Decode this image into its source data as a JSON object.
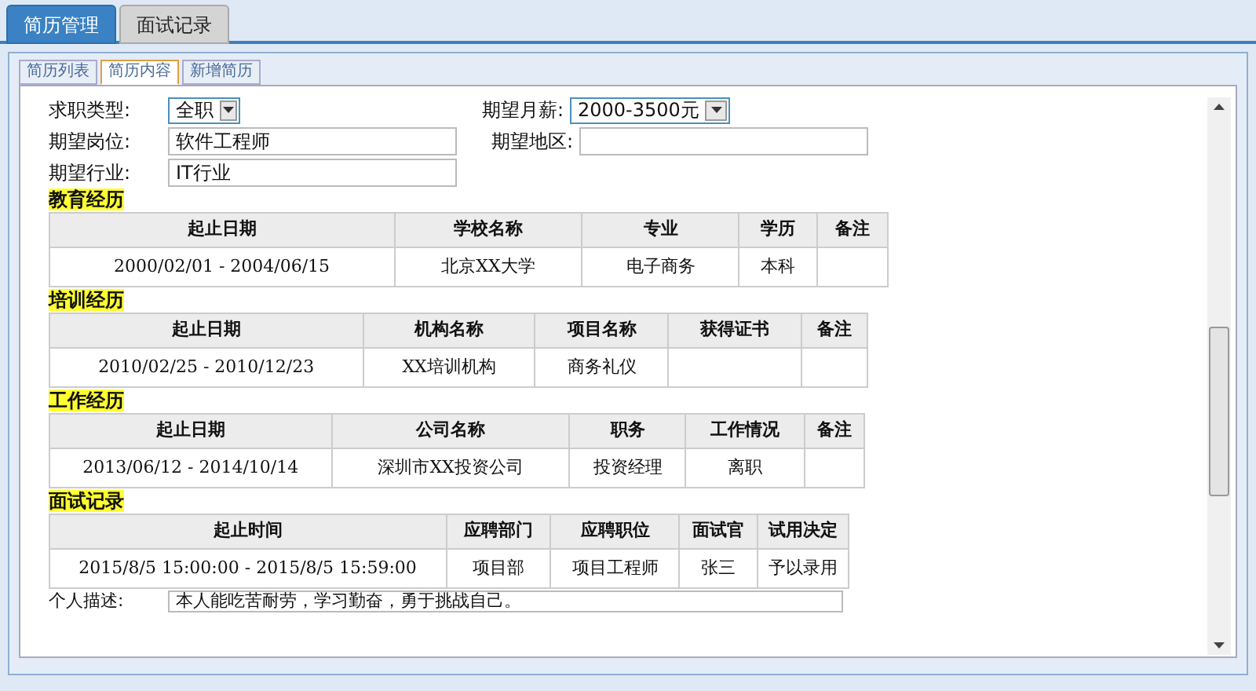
{
  "main_tabs": [
    {
      "label": "简历管理",
      "selected": true
    },
    {
      "label": "面试记录",
      "selected": false
    }
  ],
  "sub_tabs": [
    {
      "label": "简历列表",
      "selected": false
    },
    {
      "label": "简历内容",
      "selected": true
    },
    {
      "label": "新增简历",
      "selected": false
    }
  ],
  "form": {
    "job_type": {
      "label": "求职类型:",
      "value": "全职"
    },
    "salary": {
      "label": "期望月薪:",
      "value": "2000-3500元"
    },
    "position": {
      "label": "期望岗位:",
      "value": "软件工程师"
    },
    "region": {
      "label": "期望地区:"
    },
    "industry": {
      "label": "期望行业:",
      "value": "IT行业"
    }
  },
  "sections": [
    {
      "title": "教育经历",
      "columns": [
        "起止日期",
        "学校名称",
        "专业",
        "学历",
        "备注"
      ],
      "rows": [
        [
          "2000/02/01 - 2004/06/15",
          "北京XX大学",
          "电子商务",
          "本科",
          ""
        ]
      ]
    },
    {
      "title": "培训经历",
      "columns": [
        "起止日期",
        "机构名称",
        "项目名称",
        "获得证书",
        "备注"
      ],
      "rows": [
        [
          "2010/02/25 - 2010/12/23",
          "XX培训机构",
          "商务礼仪",
          "",
          ""
        ]
      ]
    },
    {
      "title": "工作经历",
      "columns": [
        "起止日期",
        "公司名称",
        "职务",
        "工作情况",
        "备注"
      ],
      "rows": [
        [
          "2013/06/12 - 2014/10/14",
          "深圳市XX投资公司",
          "投资经理",
          "离职",
          ""
        ]
      ]
    },
    {
      "title": "面试记录",
      "columns": [
        "起止时间",
        "应聘部门",
        "应聘职位",
        "面试官",
        "试用决定"
      ],
      "rows": [
        [
          "2015/8/5 15:00:00 - 2015/8/5 15:59:00",
          "项目部",
          "项目工程师",
          "张三",
          "予以录用"
        ]
      ]
    }
  ],
  "description": {
    "label": "个人描述:",
    "value": "本人能吃苦耐劳，学习勤奋，勇于挑战自己。"
  }
}
